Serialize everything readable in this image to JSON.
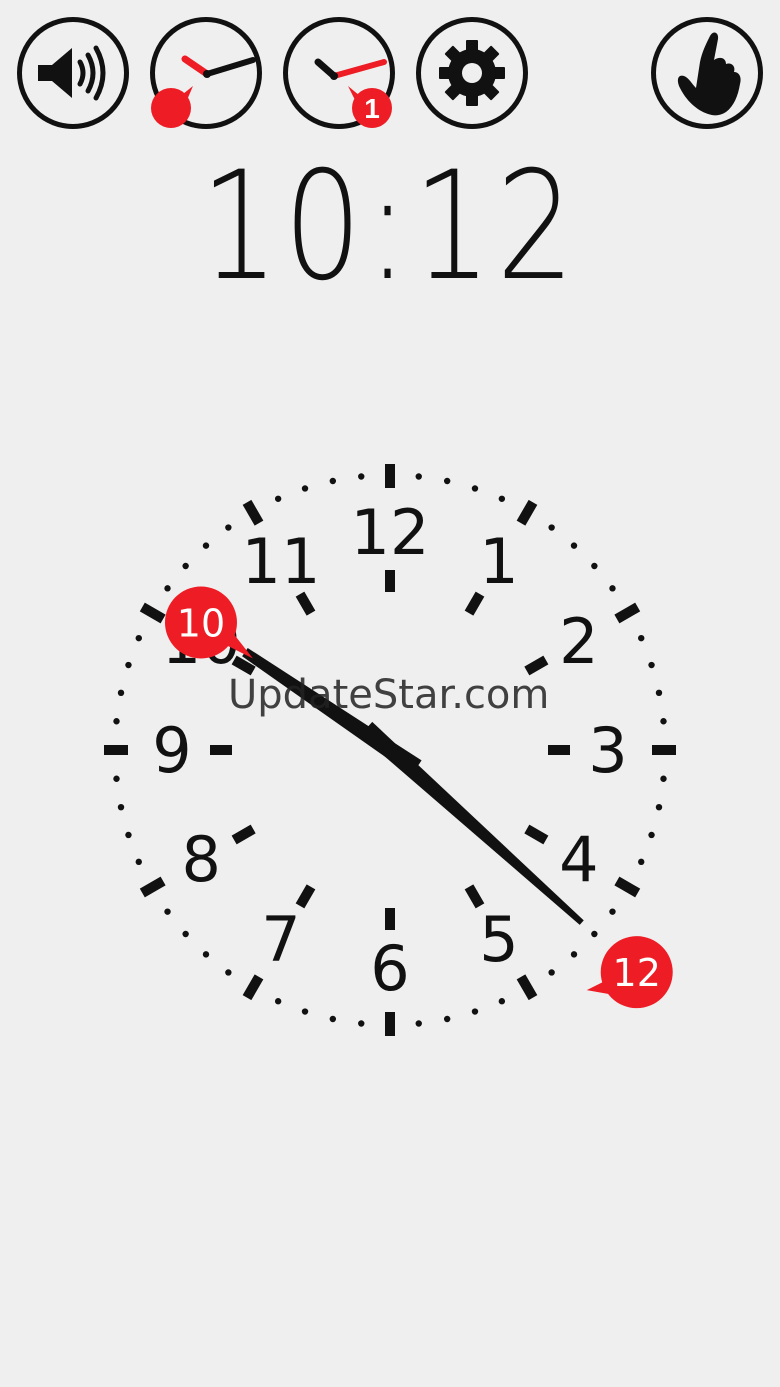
{
  "toolbar": {
    "buttons": [
      {
        "name": "sound-button",
        "icon": "speaker-icon"
      },
      {
        "name": "clock-mode-button",
        "icon": "analog-clock-icon"
      },
      {
        "name": "clock-hint-button",
        "icon": "analog-clock-hint-icon",
        "badge": "1"
      },
      {
        "name": "settings-button",
        "icon": "gear-icon"
      },
      {
        "name": "touch-mode-button",
        "icon": "pointing-hand-icon"
      }
    ]
  },
  "digital_time": "10:12",
  "clock": {
    "hour": 10,
    "minute": 12,
    "numbers": [
      "12",
      "1",
      "2",
      "3",
      "4",
      "5",
      "6",
      "7",
      "8",
      "9",
      "10",
      "11"
    ],
    "hour_bubble": "10",
    "minute_bubble": "12",
    "accent_color": "#ee1c24",
    "hand_color": "#111111"
  },
  "watermark": "UpdateStar.com",
  "colors": {
    "background": "#efefef",
    "foreground": "#111111",
    "accent": "#ee1c24"
  }
}
